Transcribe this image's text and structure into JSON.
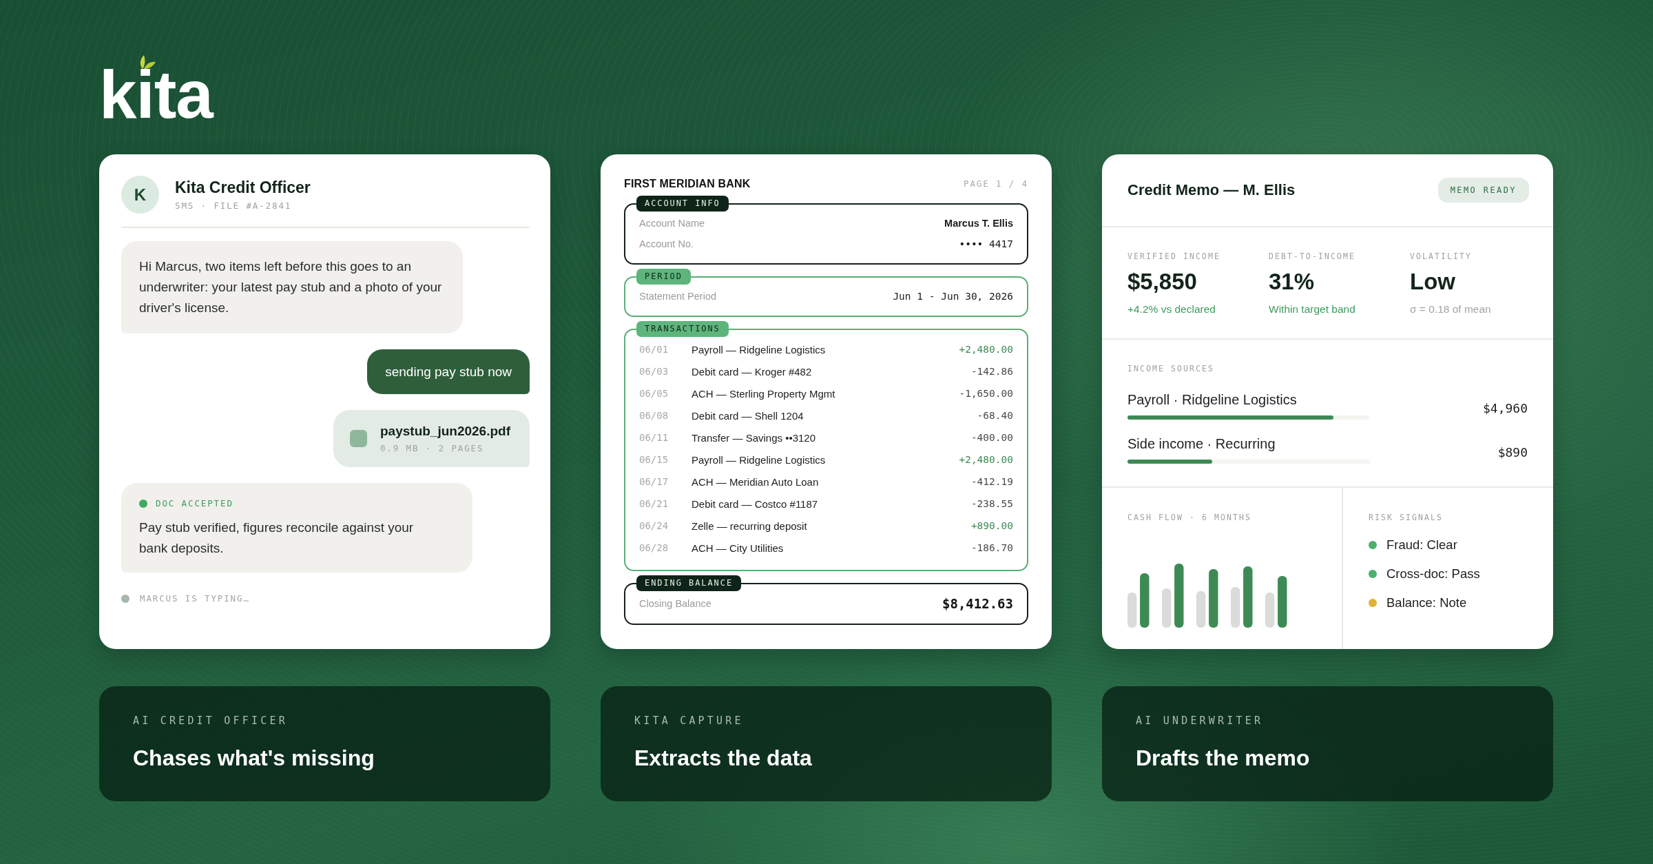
{
  "logo": {
    "text": "kita"
  },
  "chat_card": {
    "avatar": "K",
    "title": "Kita Credit Officer",
    "subtitle": "SMS · FILE #A-2841",
    "messages": [
      {
        "kind": "incoming",
        "text": "Hi Marcus, two items left before this goes to an underwriter: your latest pay stub and a photo of your driver's license."
      },
      {
        "kind": "outgoing",
        "text": "sending pay stub now"
      },
      {
        "kind": "file",
        "name": "paystub_jun2026.pdf",
        "meta": "0.9 MB · 2 PAGES"
      },
      {
        "kind": "status",
        "status": "DOC ACCEPTED",
        "text": "Pay stub verified, figures reconcile against your bank deposits."
      }
    ],
    "typing": "MARCUS IS TYPING…"
  },
  "statement_card": {
    "bank": "FIRST MERIDIAN BANK",
    "page": "PAGE 1 / 4",
    "sections": [
      {
        "kind": "info",
        "tag": "ACCOUNT INFO",
        "rows": [
          {
            "label": "Account Name",
            "value": "Marcus T. Ellis",
            "kind": "text"
          },
          {
            "label": "Account No.",
            "value": "•••• 4417",
            "kind": "mono"
          }
        ]
      },
      {
        "kind": "period",
        "tag": "PERIOD",
        "rows": [
          {
            "label": "Statement Period",
            "value": "Jun 1 - Jun 30, 2026",
            "kind": "mono"
          }
        ]
      },
      {
        "kind": "transactions",
        "tag": "TRANSACTIONS",
        "rows": [
          {
            "date": "06/01",
            "description": "Payroll — Ridgeline Logistics",
            "amount": "+2,480.00",
            "kind": "credit"
          },
          {
            "date": "06/03",
            "description": "Debit card — Kroger #482",
            "amount": "-142.86",
            "kind": "debit"
          },
          {
            "date": "06/05",
            "description": "ACH — Sterling Property Mgmt",
            "amount": "-1,650.00",
            "kind": "debit"
          },
          {
            "date": "06/08",
            "description": "Debit card — Shell 1204",
            "amount": "-68.40",
            "kind": "debit"
          },
          {
            "date": "06/11",
            "description": "Transfer — Savings ••3120",
            "amount": "-400.00",
            "kind": "debit"
          },
          {
            "date": "06/15",
            "description": "Payroll — Ridgeline Logistics",
            "amount": "+2,480.00",
            "kind": "credit"
          },
          {
            "date": "06/17",
            "description": "ACH — Meridian Auto Loan",
            "amount": "-412.19",
            "kind": "debit"
          },
          {
            "date": "06/21",
            "description": "Debit card — Costco #1187",
            "amount": "-238.55",
            "kind": "debit"
          },
          {
            "date": "06/24",
            "description": "Zelle — recurring deposit",
            "amount": "+890.00",
            "kind": "credit"
          },
          {
            "date": "06/28",
            "description": "ACH — City Utilities",
            "amount": "-186.70",
            "kind": "debit"
          }
        ]
      },
      {
        "kind": "balance",
        "tag": "ENDING BALANCE",
        "rows": [
          {
            "label": "Closing Balance",
            "value": "$8,412.63",
            "kind": "total"
          }
        ]
      }
    ]
  },
  "memo_card": {
    "title": "Credit Memo — M. Ellis",
    "badge": "MEMO READY",
    "metrics": [
      {
        "label": "VERIFIED INCOME",
        "value": "$5,850",
        "note": "+4.2% vs declared",
        "kind": "positive"
      },
      {
        "label": "DEBT-TO-INCOME",
        "value": "31%",
        "note": "Within target band",
        "kind": "positive"
      },
      {
        "label": "VOLATILITY",
        "value": "Low",
        "note": "σ = 0.18 of mean",
        "kind": "neutral"
      }
    ],
    "income_sources": {
      "title": "INCOME SOURCES",
      "items": [
        {
          "name": "Payroll · Ridgeline Logistics",
          "amount": "$4,960",
          "level": 0.85
        },
        {
          "name": "Side income · Recurring",
          "amount": "$890",
          "level": 0.35
        }
      ]
    },
    "cash_flow": {
      "title": "CASH FLOW · 6 MONTHS"
    },
    "risk_signals": {
      "title": "RISK SIGNALS",
      "items": [
        {
          "label": "Fraud: Clear",
          "color": "#4caf6e"
        },
        {
          "label": "Cross-doc: Pass",
          "color": "#4caf6e"
        },
        {
          "label": "Balance: Note",
          "color": "#e0b23c"
        }
      ]
    }
  },
  "features": [
    {
      "eyebrow": "AI CREDIT OFFICER",
      "title": "Chases what's missing"
    },
    {
      "eyebrow": "KITA CAPTURE",
      "title": "Extracts the data"
    },
    {
      "eyebrow": "AI UNDERWRITER",
      "title": "Drafts the memo"
    }
  ]
}
